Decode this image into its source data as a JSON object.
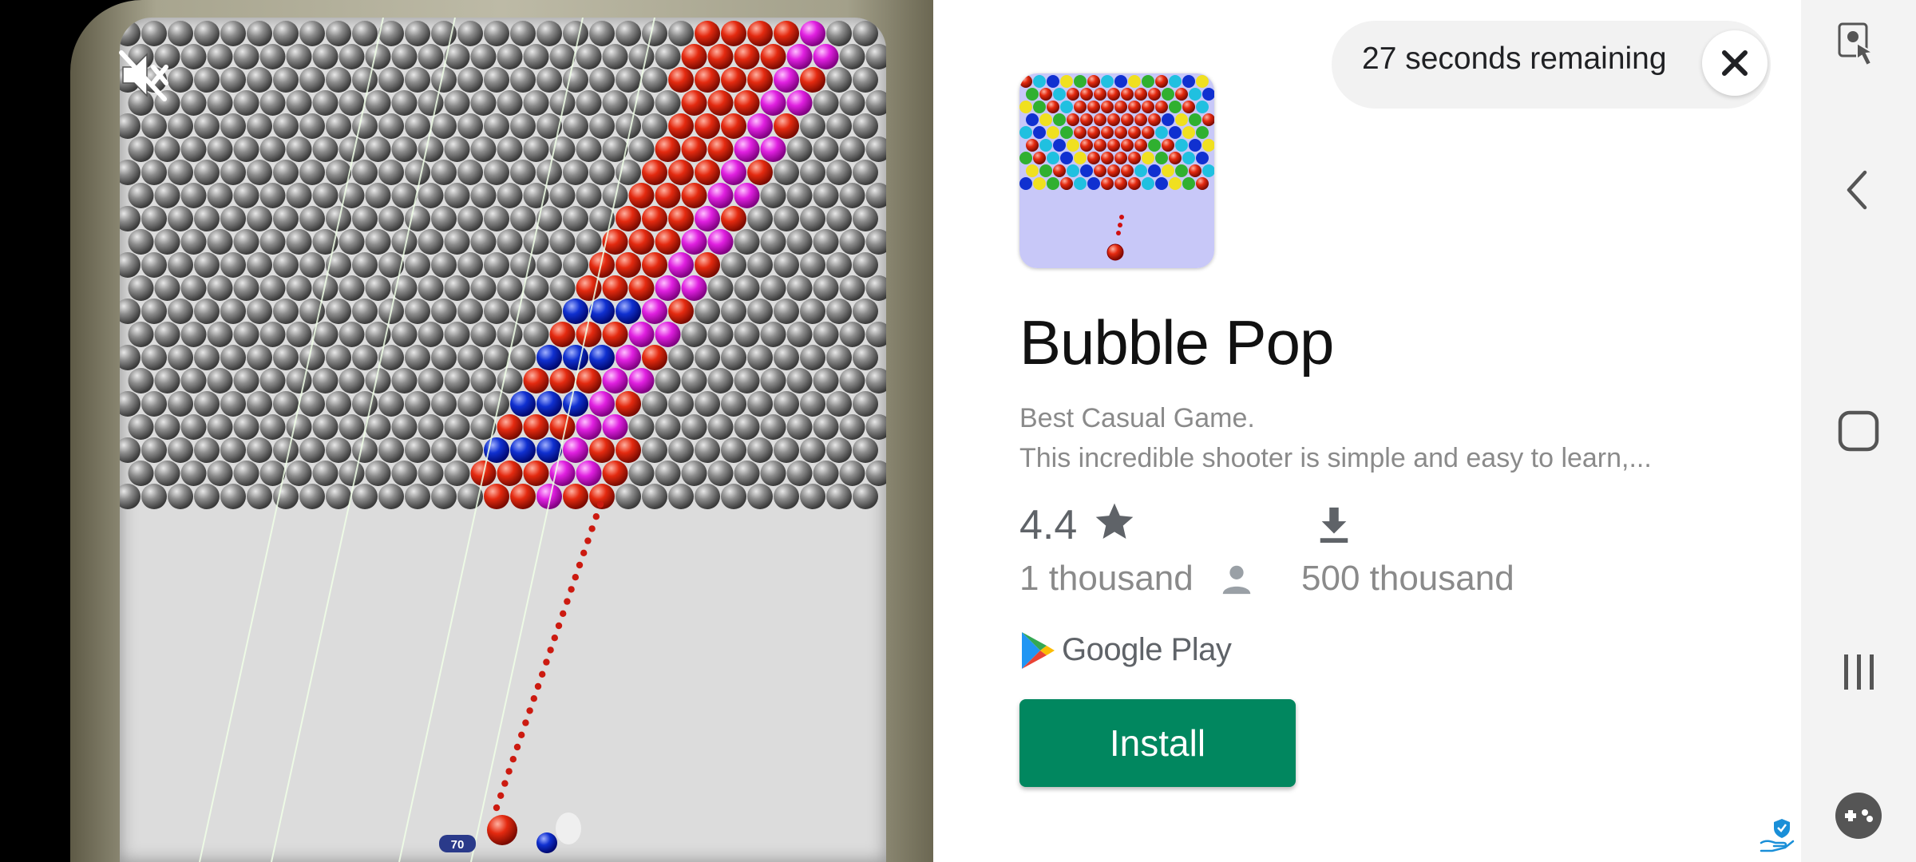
{
  "ad": {
    "timer_text": "27 seconds remaining",
    "app": {
      "title": "Bubble Pop",
      "desc_line1": "Best Casual Game.",
      "desc_line2": "This incredible shooter is simple and easy to learn,...",
      "rating": "4.4",
      "reviews": "1 thousand",
      "downloads": "500 thousand",
      "store": "Google Play",
      "install_label": "Install"
    },
    "game": {
      "shot_counter": "70"
    }
  },
  "colors": {
    "install_green": "#01875f",
    "bubble_red": "#e02010",
    "bubble_magenta": "#e020e0",
    "bubble_blue": "#1030d0",
    "bubble_gray": "#8a8a8a"
  },
  "icons": {
    "mute": "muted-speaker-icon",
    "close": "close-icon",
    "star": "star-icon",
    "person": "person-icon",
    "download": "download-icon",
    "play": "google-play-icon",
    "nav": [
      "touch-icon",
      "back-icon",
      "home-icon",
      "recents-icon",
      "game-tools-icon"
    ]
  }
}
